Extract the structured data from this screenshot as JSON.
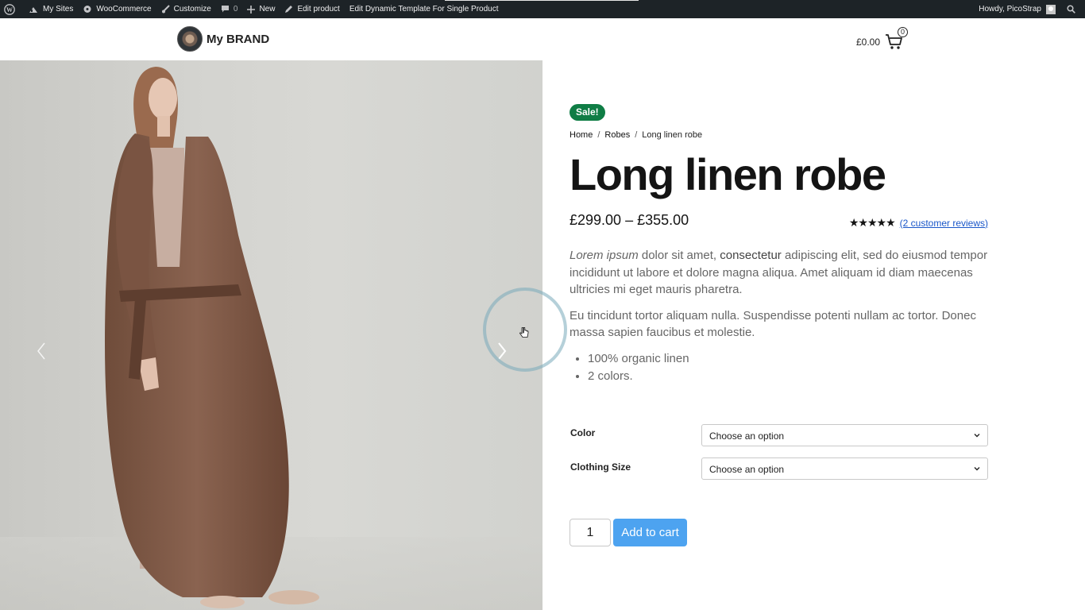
{
  "admin_bar": {
    "my_sites": "My Sites",
    "woocommerce": "WooCommerce",
    "customize": "Customize",
    "comments_count": "0",
    "new": "New",
    "edit_product": "Edit product",
    "edit_template": "Edit Dynamic Template For Single Product",
    "howdy": "Howdy, PicoStrap"
  },
  "header": {
    "brand_name": "My BRAND",
    "cart_total": "£0.00",
    "cart_count": "0"
  },
  "product": {
    "sale_badge": "Sale!",
    "breadcrumb": {
      "home": "Home",
      "category": "Robes",
      "current": "Long linen robe",
      "separator": "/"
    },
    "title": "Long linen robe",
    "price": "£299.00 – £355.00",
    "rating_stars": "★★★★★",
    "rating": 5,
    "reviews_link": "(2 customer reviews)",
    "description": {
      "p1_italic": "Lorem ipsum",
      "p1_a": " dolor sit amet, ",
      "p1_strong": "consectetur",
      "p1_b": " adipiscing elit, sed do eiusmod tempor incididunt ut labore et dolore magna aliqua. Amet aliquam id diam maecenas ultricies mi eget mauris pharetra.",
      "p2": "Eu tincidunt tortor aliquam nulla. Suspendisse potenti nullam ac tortor. Donec massa sapien faucibus et molestie."
    },
    "features": [
      "100% organic linen",
      "2 colors."
    ],
    "variations": {
      "color_label": "Color",
      "color_value": "Choose an option",
      "size_label": "Clothing Size",
      "size_value": "Choose an option"
    },
    "quantity": "1",
    "add_to_cart": "Add to cart"
  },
  "colors": {
    "admin_bar": "#1d2327",
    "sale_badge": "#0f7d45",
    "button": "#4da3f0",
    "link": "#1a57c9"
  }
}
